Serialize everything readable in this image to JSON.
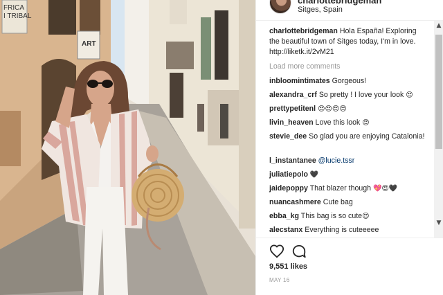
{
  "post": {
    "author": "charlottebridgeman",
    "location": "Sitges, Spain",
    "likes": "9,551 likes",
    "date": "MAY 16",
    "load_more": "Load more comments",
    "caption": {
      "username": "charlottebridgeman",
      "text": "Hola España! Exploring the beautiful town of Sitges today, I'm in love. http://liketk.it/2vM21"
    }
  },
  "comments": [
    {
      "username": "inbloomintimates",
      "text": "Gorgeous!",
      "emoji": ""
    },
    {
      "username": "alexandra_crf",
      "text": "So pretty ! I love your look",
      "emoji": "😍"
    },
    {
      "username": "prettypetitenl",
      "text": "",
      "emoji": "😍😍😍😍"
    },
    {
      "username": "livin_heaven",
      "text": "Love this look",
      "emoji": "😍"
    },
    {
      "username": "stevie_dee",
      "text": "So glad you are enjoying Catalonia!",
      "emoji": ""
    },
    {
      "username": "l_instantanee",
      "text": "",
      "mention": "@lucie.tssr",
      "emoji": ""
    },
    {
      "username": "juliatiepolo",
      "text": "",
      "emoji": "🖤"
    },
    {
      "username": "jaidepoppy",
      "text": "That blazer though",
      "emoji": "💖😍🖤"
    },
    {
      "username": "nuancashmere",
      "text": "Cute bag",
      "emoji": ""
    },
    {
      "username": "ebba_kg",
      "text": "This bag is so cute",
      "emoji": "😍"
    },
    {
      "username": "alecstanx",
      "text": "Everything is cuteeeee",
      "emoji": ""
    }
  ],
  "photo": {
    "sign_left": "FRICA\nI TRIBAL",
    "sign_shop": "ART"
  },
  "icons": {
    "like": "heart-icon",
    "comment": "speech-bubble-icon",
    "scroll_up": "chevron-up-icon",
    "scroll_down": "chevron-down-icon"
  },
  "colors": {
    "text": "#262626",
    "muted": "#999999",
    "mention": "#003569"
  }
}
